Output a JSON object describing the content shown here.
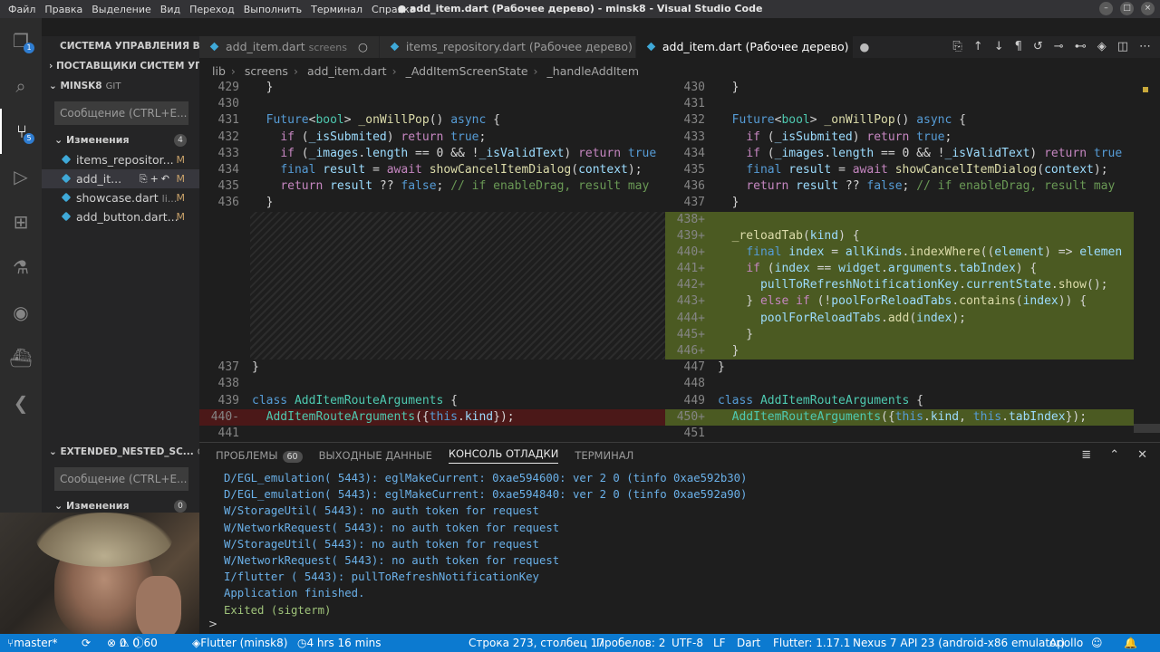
{
  "window": {
    "title": "● add_item.dart (Рабочее дерево) - minsk8 - Visual Studio Code"
  },
  "menu": [
    "Файл",
    "Правка",
    "Выделение",
    "Вид",
    "Переход",
    "Выполнить",
    "Терминал",
    "Справка"
  ],
  "activity": {
    "scm_badge": "5",
    "explorer_badge": "1"
  },
  "sidebar": {
    "title": "СИСТЕМА УПРАВЛЕНИЯ В...",
    "providers": "ПОСТАВЩИКИ СИСТЕМ УП...",
    "repo1": {
      "name": "MINSK8",
      "kind": "GIT",
      "message_placeholder": "Сообщение (CTRL+E...",
      "changes_label": "Изменения",
      "changes_count": "4",
      "files": [
        {
          "name": "items_repositor...",
          "status": "M"
        },
        {
          "name": "add_it...",
          "status": "M"
        },
        {
          "name": "showcase.dart",
          "hint": "li...",
          "status": "M"
        },
        {
          "name": "add_button.dart...",
          "status": "M"
        }
      ]
    },
    "repo2": {
      "name": "EXTENDED_NESTED_SC...",
      "kind": "GIT",
      "message_placeholder": "Сообщение (CTRL+E...",
      "changes_label": "Изменения",
      "changes_count": "0"
    }
  },
  "tabs": [
    {
      "label": "add_item.dart",
      "hint": "screens"
    },
    {
      "label": "items_repository.dart (Рабочее дерево)"
    },
    {
      "label": "add_item.dart (Рабочее дерево)"
    }
  ],
  "breadcrumbs": [
    "lib",
    "screens",
    "add_item.dart",
    "_AddItemScreenState",
    "_handleAddItem"
  ],
  "left": {
    "lines": [
      {
        "n": "429",
        "t": "  }"
      },
      {
        "n": "430",
        "t": ""
      },
      {
        "n": "431",
        "t": "  Future<bool> _onWillPop() async {"
      },
      {
        "n": "432",
        "t": "    if (_isSubmited) return true;"
      },
      {
        "n": "433",
        "t": "    if (_images.length == 0 && !_isValidText) return true"
      },
      {
        "n": "434",
        "t": "    final result = await showCancelItemDialog(context);"
      },
      {
        "n": "435",
        "t": "    return result ?? false; // if enableDrag, result may"
      },
      {
        "n": "436",
        "t": "  }"
      }
    ],
    "after": [
      {
        "n": "437",
        "t": "}"
      },
      {
        "n": "438",
        "t": ""
      },
      {
        "n": "439",
        "t": "class AddItemRouteArguments {"
      },
      {
        "n": "440-",
        "t": "  AddItemRouteArguments({this.kind});"
      },
      {
        "n": "441",
        "t": ""
      }
    ]
  },
  "right": {
    "lines": [
      {
        "n": "430",
        "t": "  }"
      },
      {
        "n": "431",
        "t": ""
      },
      {
        "n": "432",
        "t": "  Future<bool> _onWillPop() async {"
      },
      {
        "n": "433",
        "t": "    if (_isSubmited) return true;"
      },
      {
        "n": "434",
        "t": "    if (_images.length == 0 && !_isValidText) return true"
      },
      {
        "n": "435",
        "t": "    final result = await showCancelItemDialog(context);"
      },
      {
        "n": "436",
        "t": "    return result ?? false; // if enableDrag, result may"
      },
      {
        "n": "437",
        "t": "  }"
      }
    ],
    "added": [
      {
        "n": "438+",
        "t": ""
      },
      {
        "n": "439+",
        "t": "  _reloadTab(kind) {"
      },
      {
        "n": "440+",
        "t": "    final index = allKinds.indexWhere((element) => elemen"
      },
      {
        "n": "441+",
        "t": "    if (index == widget.arguments.tabIndex) {"
      },
      {
        "n": "442+",
        "t": "      pullToRefreshNotificationKey.currentState.show();"
      },
      {
        "n": "443+",
        "t": "    } else if (!poolForReloadTabs.contains(index)) {"
      },
      {
        "n": "444+",
        "t": "      poolForReloadTabs.add(index);"
      },
      {
        "n": "445+",
        "t": "    }"
      },
      {
        "n": "446+",
        "t": "  }"
      }
    ],
    "after": [
      {
        "n": "447",
        "t": "}"
      },
      {
        "n": "448",
        "t": ""
      },
      {
        "n": "449",
        "t": "class AddItemRouteArguments {"
      },
      {
        "n": "450+",
        "t": "  AddItemRouteArguments({this.kind, this.tabIndex});"
      },
      {
        "n": "451",
        "t": ""
      }
    ]
  },
  "panel": {
    "tabs": [
      {
        "label": "ПРОБЛЕМЫ",
        "count": "60"
      },
      {
        "label": "ВЫХОДНЫЕ ДАННЫЕ"
      },
      {
        "label": "КОНСОЛЬ ОТЛАДКИ"
      },
      {
        "label": "ТЕРМИНАЛ"
      }
    ],
    "console": [
      "D/EGL_emulation( 5443): eglMakeCurrent: 0xae594600: ver 2 0 (tinfo 0xae592b30)",
      "D/EGL_emulation( 5443): eglMakeCurrent: 0xae594840: ver 2 0 (tinfo 0xae592a90)",
      "W/StorageUtil( 5443): no auth token for request",
      "W/NetworkRequest( 5443): no auth token for request",
      "W/StorageUtil( 5443): no auth token for request",
      "W/NetworkRequest( 5443): no auth token for request",
      "I/flutter ( 5443): pullToRefreshNotificationKey",
      "Application finished."
    ],
    "exited": "Exited (sigterm)",
    "prompt": ">"
  },
  "status": {
    "branch": "master*",
    "errors": "0",
    "warnings": "0",
    "infos": "60",
    "flutter": "Flutter (minsk8)",
    "time": "4 hrs 16 mins",
    "position": "Строка 273, столбец 17",
    "spaces": "Пробелов: 2",
    "encoding": "UTF-8",
    "eol": "LF",
    "lang": "Dart",
    "flutter_ver": "Flutter: 1.17.1",
    "device": "Nexus 7 API 23 (android-x86 emulator)",
    "apollo": "Apollo"
  }
}
